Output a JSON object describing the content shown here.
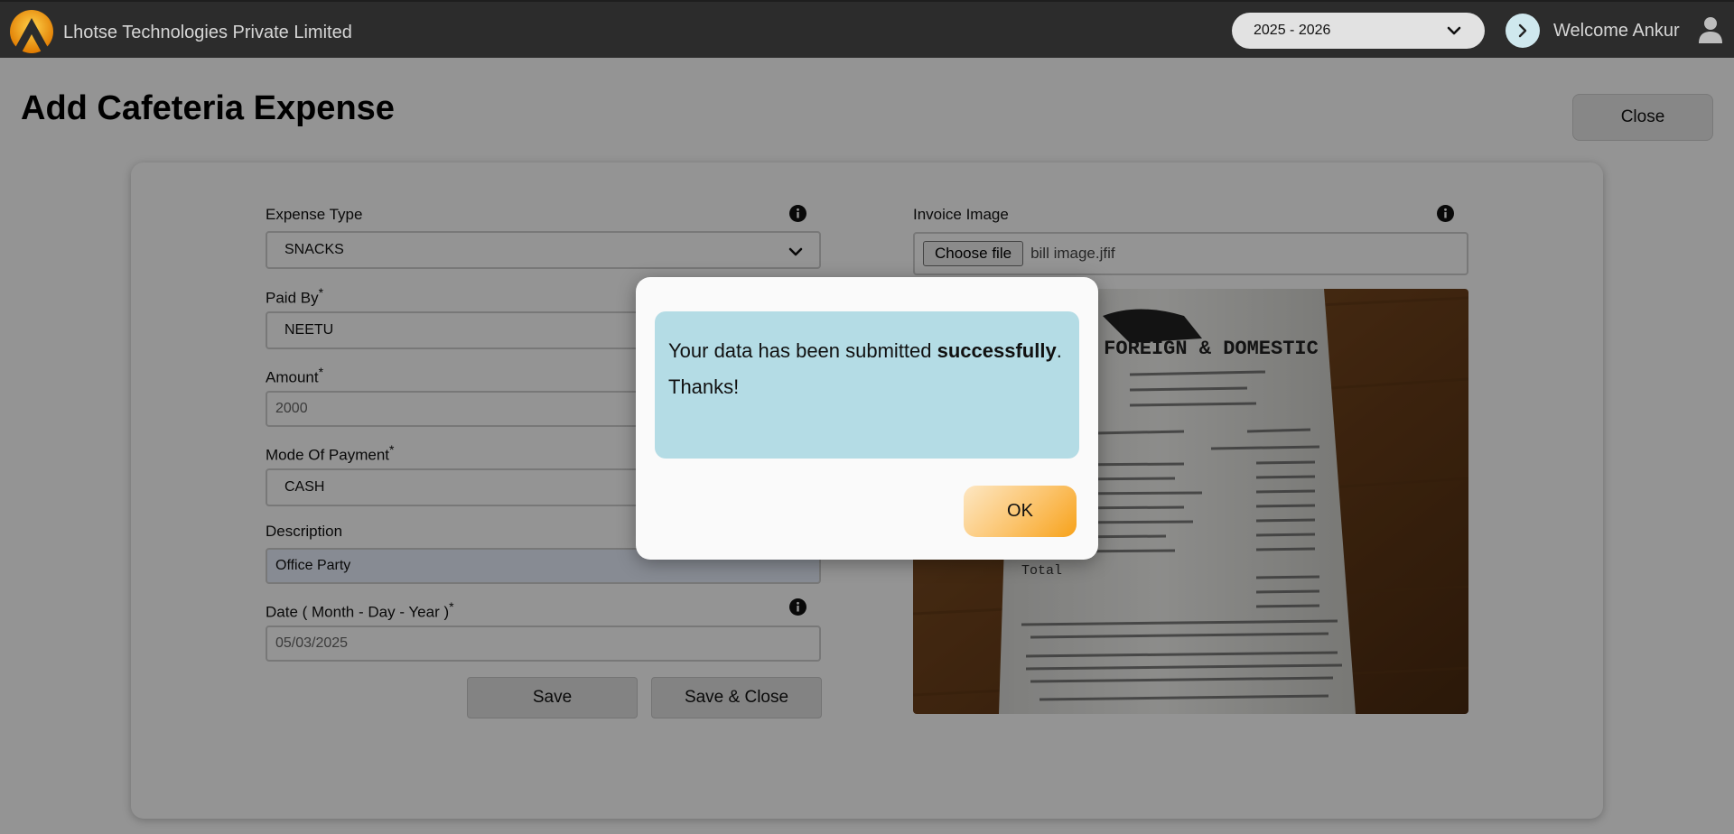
{
  "header": {
    "company_name": "Lhotse Technologies Private Limited",
    "financial_year": "2025 - 2026",
    "welcome_text": "Welcome Ankur"
  },
  "page": {
    "title": "Add Cafeteria Expense",
    "close_label": "Close"
  },
  "form": {
    "expense_type": {
      "label": "Expense Type",
      "value": "SNACKS"
    },
    "paid_by": {
      "label": "Paid By",
      "required_mark": "*",
      "value": "NEETU"
    },
    "amount": {
      "label": "Amount",
      "required_mark": "*",
      "placeholder": "2000"
    },
    "mode_of_payment": {
      "label": "Mode Of Payment",
      "required_mark": "*",
      "value": "CASH"
    },
    "description": {
      "label": "Description",
      "value": "Office Party"
    },
    "date": {
      "label": "Date ( Month - Day - Year )",
      "required_mark": "*",
      "value": "05/03/2025"
    },
    "save_label": "Save",
    "save_close_label": "Save & Close"
  },
  "invoice": {
    "label": "Invoice Image",
    "choose_file_label": "Choose file",
    "file_name": "bill image.jfif",
    "receipt_text": {
      "store": "FOREIGN & DOMESTIC",
      "total": "Total"
    }
  },
  "dialog": {
    "message_prefix": "Your data has been submitted ",
    "message_bold": "successfully",
    "message_suffix": ".",
    "message_thanks": "Thanks!",
    "ok_label": "OK"
  },
  "colors": {
    "topbar": "#2c2c2c",
    "message_bg": "#b4dce5",
    "ok_gradient_end": "#f7a21a"
  }
}
